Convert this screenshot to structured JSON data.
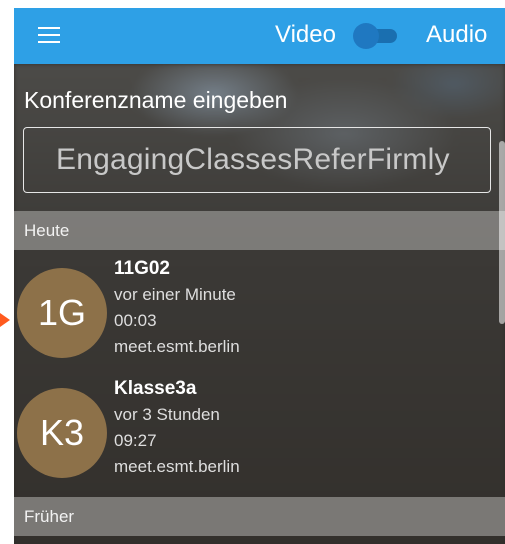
{
  "appbar": {
    "video_label": "Video",
    "audio_label": "Audio",
    "audio_only_toggle": {
      "state": "off"
    }
  },
  "prompt_label": "Konferenzname eingeben",
  "room_input": {
    "placeholder": "EngagingClassesReferFirmly",
    "value": ""
  },
  "sections": {
    "today": "Heute",
    "earlier": "Früher"
  },
  "recent_conferences": [
    {
      "initials": "1G",
      "name": "11G02",
      "when": "vor einer Minute",
      "duration": "00:03",
      "server": "meet.esmt.berlin"
    },
    {
      "initials": "K3",
      "name": "Klasse3a",
      "when": "vor 3 Stunden",
      "duration": "09:27",
      "server": "meet.esmt.berlin"
    }
  ],
  "colors": {
    "appbar": "#2ea0e6",
    "avatar": "#8d7149",
    "toggle": "#1f78c1"
  }
}
